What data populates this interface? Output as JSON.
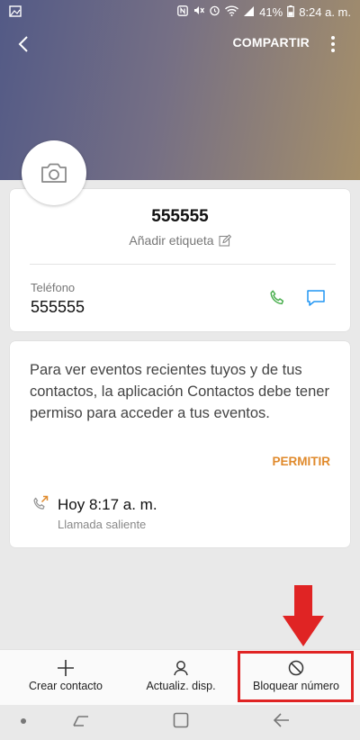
{
  "status_bar": {
    "battery": "41%",
    "time": "8:24 a. m."
  },
  "topbar": {
    "share_label": "COMPARTIR",
    "back_icon": "arrow-back-icon",
    "more_icon": "more-vertical-icon"
  },
  "contact": {
    "name": "555555",
    "add_label": "Añadir etiqueta",
    "phone_label": "Teléfono",
    "phone_number": "555555"
  },
  "events": {
    "permission_text": "Para ver eventos recientes tuyos y de tus contactos, la aplicación Contactos debe tener permiso para acceder a tus eventos.",
    "allow_label": "PERMITIR",
    "recent_call": {
      "time": "Hoy 8:17 a. m.",
      "type": "Llamada saliente"
    }
  },
  "bottom_actions": [
    {
      "label": "Crear contacto",
      "icon": "plus-icon"
    },
    {
      "label": "Actualiz. disp.",
      "icon": "person-icon"
    },
    {
      "label": "Bloquear número",
      "icon": "block-icon"
    }
  ],
  "colors": {
    "accent_orange": "#e08a2c",
    "call_green": "#4caf50",
    "message_blue": "#2196f3",
    "annotation_red": "#e02424"
  }
}
